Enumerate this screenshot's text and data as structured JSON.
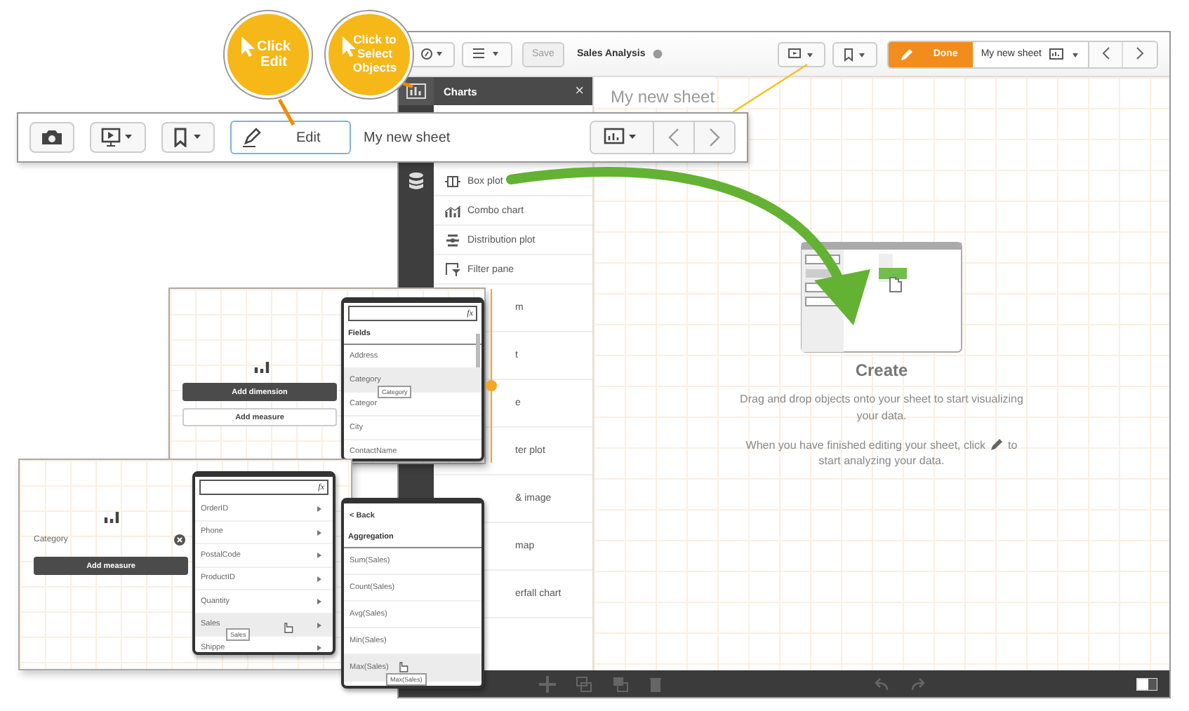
{
  "callouts": [
    {
      "lines": [
        "Click",
        "Edit"
      ]
    },
    {
      "lines": [
        "Click to",
        "Select",
        "Objects"
      ]
    }
  ],
  "app": {
    "toolbar": {
      "save": "Save",
      "title": "Sales Analysis",
      "done": "Done",
      "sheet_name": "My new sheet"
    },
    "charts_panel": {
      "title": "Charts",
      "close": "×",
      "items": [
        {
          "label": "Box plot",
          "covered": false
        },
        {
          "label": "Combo chart",
          "covered": false
        },
        {
          "label": "Distribution plot",
          "covered": false
        },
        {
          "label": "Filter pane",
          "covered": false
        },
        {
          "label": "m",
          "covered": true
        },
        {
          "label": "t",
          "covered": true
        },
        {
          "label": "e",
          "covered": true
        },
        {
          "label": "ter plot",
          "covered": true
        },
        {
          "label": "& image",
          "covered": true
        },
        {
          "label": "map",
          "covered": true
        },
        {
          "label": "erfall chart",
          "covered": true
        }
      ]
    },
    "sheet": {
      "title": "My new sheet",
      "heading": "Create",
      "hint": "Drag and drop objects onto your sheet to start visualizing your data.",
      "hint2_start": "When you have finished editing your sheet, click",
      "hint2_mid": "to",
      "hint2_end": "start analyzing your data."
    }
  },
  "edit_toolbar": {
    "edit": "Edit",
    "sheet_name": "My new sheet"
  },
  "dimension_editor": {
    "buttons": [
      {
        "label": "Add dimension",
        "kind": "primary"
      },
      {
        "label": "Add measure",
        "kind": "secondary"
      }
    ],
    "popup": {
      "header": "Fields",
      "items": [
        {
          "label": "Address",
          "highlighted": false
        },
        {
          "label": "Category",
          "highlighted": true
        },
        {
          "label": "Categor",
          "highlighted": false
        },
        {
          "label": "City",
          "highlighted": false
        },
        {
          "label": "ContactName",
          "highlighted": false
        }
      ],
      "tooltip": "Category",
      "formula": "fx"
    }
  },
  "measure_editor": {
    "dimension": "Category",
    "button": "Add measure",
    "popup": {
      "items": [
        {
          "label": "OrderID",
          "highlighted": false
        },
        {
          "label": "Phone",
          "highlighted": false
        },
        {
          "label": "PostalCode",
          "highlighted": false
        },
        {
          "label": "ProductID",
          "highlighted": false
        },
        {
          "label": "Quantity",
          "highlighted": false
        },
        {
          "label": "Sales",
          "highlighted": true
        },
        {
          "label": "Shippe",
          "highlighted": false
        }
      ],
      "tooltip": "Sales",
      "formula": "fx"
    }
  },
  "aggregation_popup": {
    "back": "< Back",
    "header": "Aggregation",
    "items": [
      {
        "label": "Sum(Sales)",
        "highlighted": false
      },
      {
        "label": "Count(Sales)",
        "highlighted": false
      },
      {
        "label": "Avg(Sales)",
        "highlighted": false
      },
      {
        "label": "Min(Sales)",
        "highlighted": false
      },
      {
        "label": "Max(Sales)",
        "highlighted": true
      }
    ],
    "tooltip": "Max(Sales)"
  }
}
